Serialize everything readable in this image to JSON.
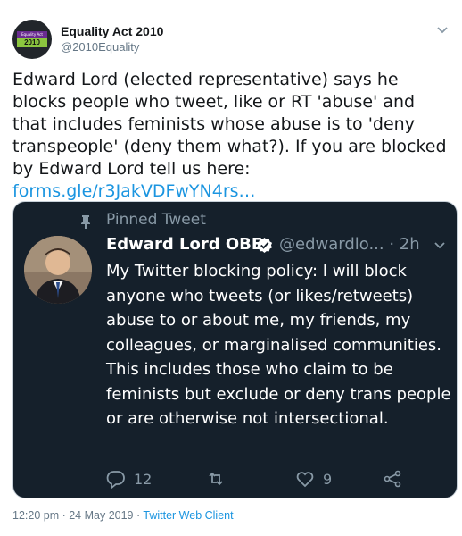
{
  "author": {
    "name": "Equality Act 2010",
    "handle": "@2010Equality",
    "avatar_badge_top": "Equality Act",
    "avatar_badge_bottom": "2010"
  },
  "tweet": {
    "text": "Edward Lord (elected representative) says he blocks people who tweet, like or RT 'abuse' and that includes feminists whose abuse is to 'deny transpeople' (deny them what?). If you are blocked by Edward Lord tell us here:",
    "link": "forms.gle/r3JakVDFwYN4rs…"
  },
  "embedded": {
    "pinned_label": "Pinned Tweet",
    "name": "Edward Lord OBE",
    "handle_time": "@edwardlo... · 2h",
    "text": "My Twitter blocking policy: I will block anyone who tweets (or likes/retweets) abuse to or about me, my friends, my colleagues, or marginalised communities. This includes those who claim to be feminists but exclude or deny trans people or are otherwise not intersectional.",
    "reply_count": "12",
    "like_count": "9",
    "colors": {
      "background": "#15202b",
      "muted": "#8899a6",
      "verified": "#ffffff"
    }
  },
  "footer": {
    "timestamp": "12:20 pm · 24 May 2019 · ",
    "client": "Twitter Web Client"
  },
  "colors": {
    "link": "#1b95e0",
    "muted": "#657786",
    "text": "#14171a"
  }
}
